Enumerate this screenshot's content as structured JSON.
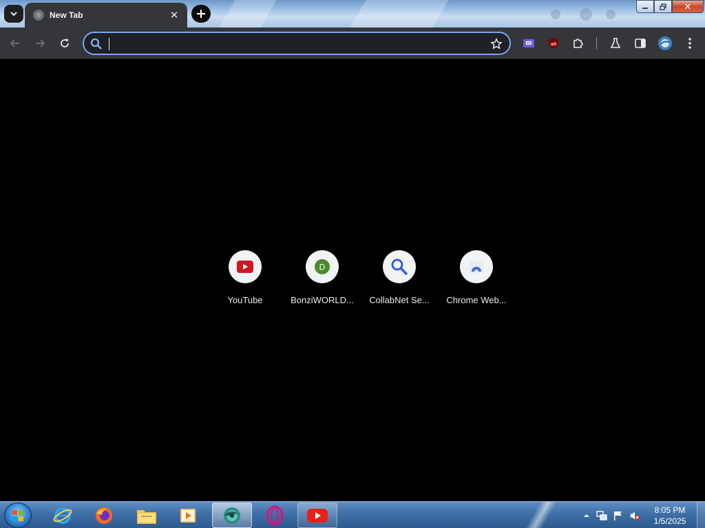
{
  "browser": {
    "tab": {
      "title": "New Tab",
      "close_icon": "close-icon",
      "favicon": "globe-icon"
    },
    "omnibox": {
      "value": "",
      "placeholder": ""
    },
    "toolbar_icons": [
      "back-arrow-icon",
      "forward-arrow-icon",
      "reload-icon",
      "search-icon",
      "bookmark-star-icon",
      "extension-twitch-icon",
      "extension-ublock-icon",
      "extensions-puzzle-icon",
      "labs-flask-icon",
      "side-panel-icon",
      "profile-avatar-icon",
      "menu-dots-icon"
    ]
  },
  "shortcuts": [
    {
      "label": "YouTube",
      "icon": "youtube-icon"
    },
    {
      "label": "BonziWORLD...",
      "icon": "letter-d-icon",
      "letter": "D"
    },
    {
      "label": "CollabNet Se...",
      "icon": "magnifier-icon"
    },
    {
      "label": "Chrome Web...",
      "icon": "chrome-web-store-icon"
    }
  ],
  "taskbar": {
    "apps": [
      "internet-explorer-icon",
      "firefox-icon",
      "file-explorer-icon",
      "media-player-icon",
      "chrome-app-icon",
      "opera-icon",
      "youtube-app-icon"
    ],
    "clock": {
      "time": "8:05 PM",
      "date": "1/5/2025"
    }
  },
  "colors": {
    "accent": "#7aa7f7",
    "toolbar": "#35363a",
    "background": "#000000",
    "youtube": "#cc181e",
    "bonzi": "#4a8a2a"
  }
}
